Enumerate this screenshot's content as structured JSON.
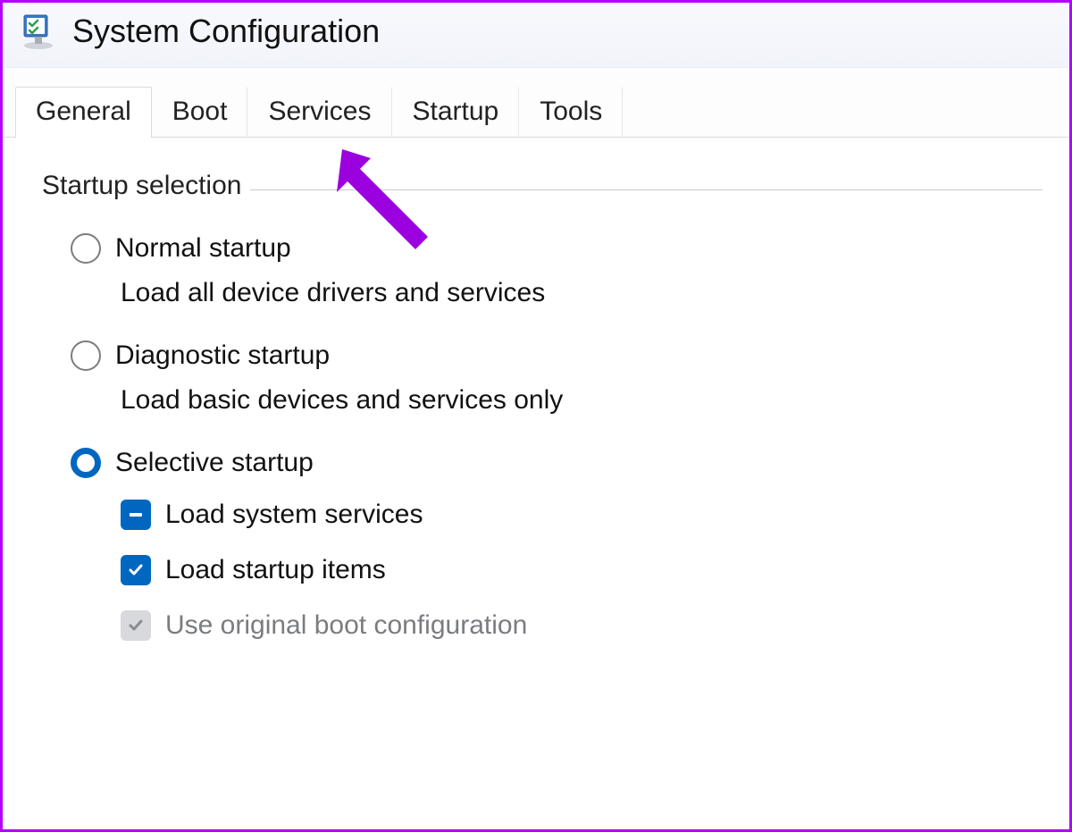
{
  "window": {
    "title": "System Configuration",
    "icon": "msconfig-icon"
  },
  "tabs": [
    {
      "label": "General",
      "active": true
    },
    {
      "label": "Boot",
      "active": false
    },
    {
      "label": "Services",
      "active": false
    },
    {
      "label": "Startup",
      "active": false
    },
    {
      "label": "Tools",
      "active": false
    }
  ],
  "group": {
    "legend": "Startup selection",
    "options": [
      {
        "key": "normal",
        "label": "Normal startup",
        "desc": "Load all device drivers and services",
        "selected": false
      },
      {
        "key": "diagnostic",
        "label": "Diagnostic startup",
        "desc": "Load basic devices and services only",
        "selected": false
      },
      {
        "key": "selective",
        "label": "Selective startup",
        "desc": "",
        "selected": true
      }
    ],
    "selective_checks": [
      {
        "key": "load-system-services",
        "label": "Load system services",
        "state": "indeterminate",
        "disabled": false
      },
      {
        "key": "load-startup-items",
        "label": "Load startup items",
        "state": "checked",
        "disabled": false
      },
      {
        "key": "use-original-boot-config",
        "label": "Use original boot configuration",
        "state": "checked",
        "disabled": true
      }
    ]
  },
  "annotation": {
    "arrow_color": "#9b00de",
    "points_to_tab": "Services"
  }
}
